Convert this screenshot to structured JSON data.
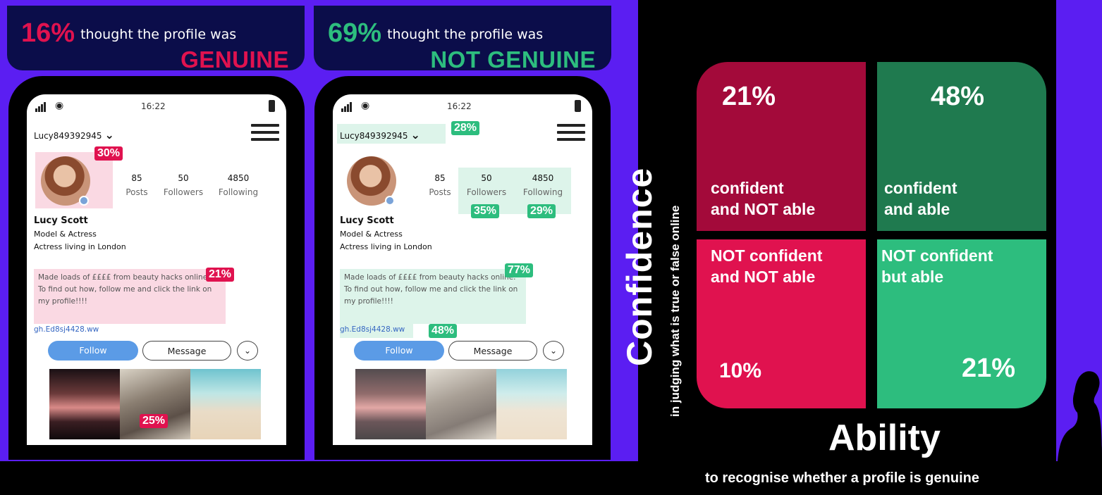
{
  "left_panel": {
    "percent": "16%",
    "text": "thought the profile was",
    "verdict": "GENUINE"
  },
  "right_panel": {
    "percent": "69%",
    "text": "thought the profile was",
    "verdict": "NOT GENUINE"
  },
  "profile": {
    "time": "16:22",
    "username": "Lucy849392945",
    "posts_count": "85",
    "posts_label": "Posts",
    "followers_count": "50",
    "followers_label": "Followers",
    "following_count": "4850",
    "following_label": "Following",
    "name": "Lucy Scott",
    "bio_line1": "Model & Actress",
    "bio_line2": "Actress living in London",
    "post_text": "Made loads of ££££ from beauty hacks online. To find out how, follow me and click the link on my profile!!!!",
    "link": "gh.Ed8sj4428.ww",
    "follow_label": "Follow",
    "message_label": "Message"
  },
  "phone1_tags": {
    "avatar": "30%",
    "post": "21%",
    "photos": "25%"
  },
  "phone2_tags": {
    "username": "28%",
    "followers": "35%",
    "following": "29%",
    "post": "77%",
    "link": "48%"
  },
  "matrix": {
    "y_title": "Confidence",
    "y_subtitle": "in judging what is true or false online",
    "x_title": "Ability",
    "x_subtitle": "to recognise whether a profile is genuine",
    "top_left": {
      "percent": "21%",
      "label_line1": "confident",
      "label_line2": "and NOT able"
    },
    "top_right": {
      "percent": "48%",
      "label_line1": "confident",
      "label_line2": "and able"
    },
    "bottom_left": {
      "percent": "10%",
      "label_line1": "NOT confident",
      "label_line2": "and NOT able"
    },
    "bottom_right": {
      "percent": "21%",
      "label_line1": "NOT confident",
      "label_line2": "but able"
    }
  },
  "colors": {
    "purple": "#5b1ef2",
    "navy": "#0b0d4a",
    "pink": "#e0124f",
    "dark_pink": "#a30a3a",
    "green": "#2dbd7e",
    "dark_green": "#1f7a4f"
  }
}
